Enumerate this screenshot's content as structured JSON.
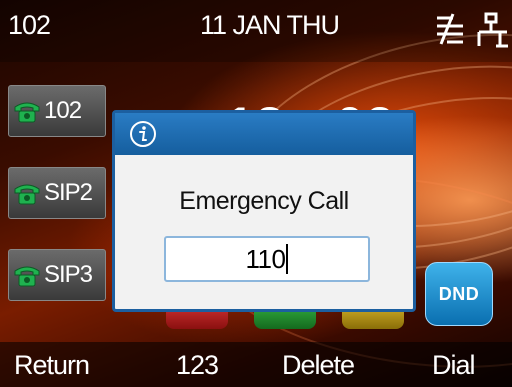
{
  "status_bar": {
    "extension": "102",
    "date": "11 JAN THU",
    "icons": [
      "network-disconnected-icon",
      "ethernet-icon"
    ]
  },
  "clock": {
    "time": "18 : 02"
  },
  "line_keys": [
    {
      "label": "102",
      "icon": "phone-icon"
    },
    {
      "label": "SIP2",
      "icon": "phone-icon"
    },
    {
      "label": "SIP3",
      "icon": "phone-icon"
    }
  ],
  "dsskey_dnd": {
    "label": "DND"
  },
  "dialog": {
    "icon": "info-icon",
    "title": "Emergency Call",
    "input_value": "110"
  },
  "softkeys": [
    "Return",
    "123",
    "Delete",
    "Dial"
  ],
  "colors": {
    "dialog_header": "#1f6db3",
    "phone_icon": "#1aa84a",
    "dnd": "#1a8fd6"
  }
}
